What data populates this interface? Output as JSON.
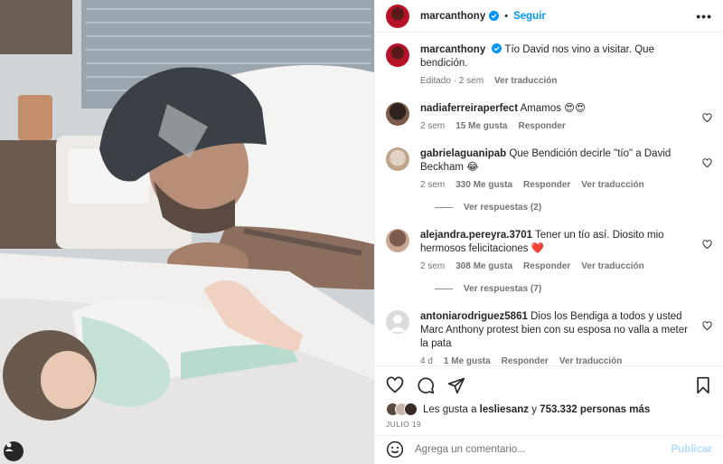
{
  "post": {
    "username": "marcanthony",
    "follow_label": "Seguir",
    "dot": "•",
    "more_label": "•••",
    "caption": "Tío David nos vino a visitar. Que bendición.",
    "caption_time": "Editado · 2 sem",
    "caption_translate": "Ver traducción"
  },
  "comments": [
    {
      "user": "nadiaferreiraperfect",
      "text": "Amamos 😍😍",
      "time": "2 sem",
      "likes": "15 Me gusta",
      "reply": "Responder",
      "translate": ""
    },
    {
      "user": "gabrielaguanipab",
      "text": "Que Bendición decirle \"tío\" a David Beckham 😂",
      "time": "2 sem",
      "likes": "330 Me gusta",
      "reply": "Responder",
      "translate": "Ver traducción",
      "replies": "Ver respuestas (2)"
    },
    {
      "user": "alejandra.pereyra.3701",
      "text": "Tener un tío así. Diosito mio hermosos felicitaciones ❤️",
      "time": "2 sem",
      "likes": "308 Me gusta",
      "reply": "Responder",
      "translate": "Ver traducción",
      "replies": "Ver respuestas (7)"
    },
    {
      "user": "antoniarodriguez5861",
      "text": "Dios los Bendiga a todos y usted Marc Anthony protest bien con su esposa no valla a meter la pata",
      "time": "4 d",
      "likes": "1 Me gusta",
      "reply": "Responder",
      "translate": "Ver traducción"
    }
  ],
  "likes_line": {
    "prefix": "Les gusta a",
    "user": "lesliesanz",
    "middle": "y",
    "count": "753.332 personas más"
  },
  "date": "JULIO 19",
  "add_comment": {
    "placeholder": "Agrega un comentario...",
    "publish_label": "Publicar"
  },
  "colors": {
    "link": "#0095f6",
    "publish_disabled": "#b3dbff",
    "muted": "#737373",
    "heart": "#ed4956",
    "verified": "#0095f6"
  }
}
